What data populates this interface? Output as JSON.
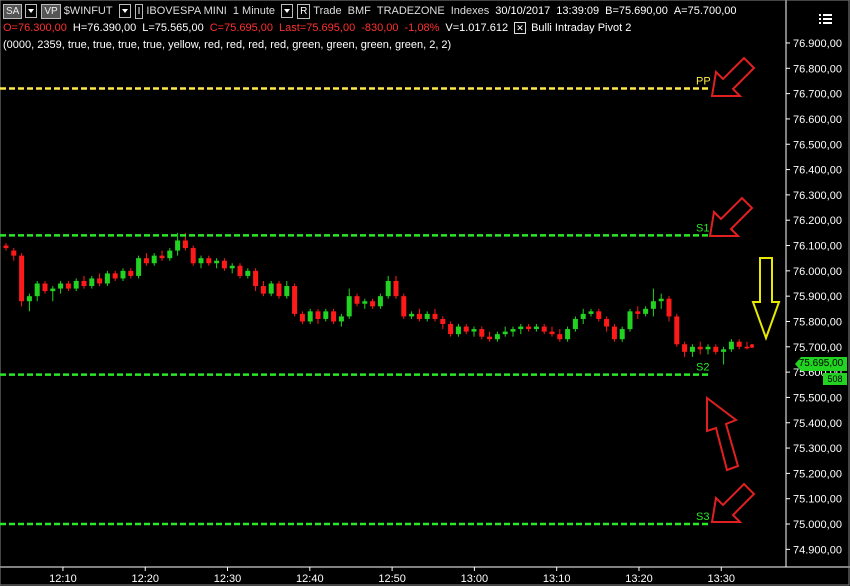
{
  "header": {
    "sa_label": "SA",
    "vp_label": "VP",
    "symbol": "$WINFUT",
    "instrument_name": "IBOVESPA MINI",
    "interval": "1 Minute",
    "interval_button": "I",
    "mode_button": "R",
    "trade_label": "Trade",
    "exchange": "BMF",
    "provider": "TRADEZONE",
    "category": "Indexes",
    "date": "30/10/2017",
    "time": "13:39:09",
    "bid": "B=75.690,00",
    "ask": "A=75.700,00",
    "open": "O=76.300,00",
    "high": "H=76.390,00",
    "low": "L=75.565,00",
    "close": "C=75.695,00",
    "last": "Last=75.695,00",
    "change": "-830,00",
    "change_pct": "-1,08%",
    "volume": "V=1.017.612",
    "indicator_name": "Bulli Intraday Pivot 2",
    "indicator_params": "(0000,  2359,  true,  true,  true,  true,  yellow,  red,  red,  red,  red,  green,  green,  green,  green,  2,  2)",
    "menu_icon": "hamburger-list-icon"
  },
  "current_price_label": "75.695,00",
  "volume_label": "508",
  "colors": {
    "background": "#000000",
    "up_candle": "#22d322",
    "down_candle": "#ff1a1a",
    "pivot_line": "#ffe84a",
    "support_line": "#28e828",
    "arrow_red": "#e02020",
    "arrow_yellow": "#e8e800",
    "axis_text": "#ffffff",
    "red_text": "#ff3030"
  },
  "chart_data": {
    "type": "candlestick",
    "ylim": [
      74850,
      77050
    ],
    "y_ticks": [
      {
        "value": 76900,
        "label": "76.900,00"
      },
      {
        "value": 76800,
        "label": "76.800,00"
      },
      {
        "value": 76700,
        "label": "76.700,00"
      },
      {
        "value": 76600,
        "label": "76.600,00"
      },
      {
        "value": 76500,
        "label": "76.500,00"
      },
      {
        "value": 76400,
        "label": "76.400,00"
      },
      {
        "value": 76300,
        "label": "76.300,00"
      },
      {
        "value": 76200,
        "label": "76.200,00"
      },
      {
        "value": 76100,
        "label": "76.100,00"
      },
      {
        "value": 76000,
        "label": "76.000,00"
      },
      {
        "value": 75900,
        "label": "75.900,00"
      },
      {
        "value": 75800,
        "label": "75.800,00"
      },
      {
        "value": 75700,
        "label": "75.700,00"
      },
      {
        "value": 75600,
        "label": "75.600,00"
      },
      {
        "value": 75500,
        "label": "75.500,00"
      },
      {
        "value": 75400,
        "label": "75.400,00"
      },
      {
        "value": 75300,
        "label": "75.300,00"
      },
      {
        "value": 75200,
        "label": "75.200,00"
      },
      {
        "value": 75100,
        "label": "75.100,00"
      },
      {
        "value": 75000,
        "label": "75.000,00"
      },
      {
        "value": 74900,
        "label": "74.900,00"
      }
    ],
    "x_ticks": [
      "12:10",
      "12:20",
      "12:30",
      "12:40",
      "12:50",
      "13:00",
      "13:10",
      "13:20",
      "13:30"
    ],
    "pivot_levels": [
      {
        "name": "PP",
        "value": 76720,
        "color": "#ffe84a"
      },
      {
        "name": "S1",
        "value": 76140,
        "color": "#28e828"
      },
      {
        "name": "S2",
        "value": 75590,
        "color": "#28e828"
      },
      {
        "name": "S3",
        "value": 75000,
        "color": "#28e828"
      }
    ],
    "candles": [
      {
        "o": 76100,
        "h": 76110,
        "l": 76080,
        "c": 76090
      },
      {
        "o": 76080,
        "h": 76090,
        "l": 76040,
        "c": 76060
      },
      {
        "o": 76060,
        "h": 76070,
        "l": 75860,
        "c": 75880
      },
      {
        "o": 75880,
        "h": 75910,
        "l": 75840,
        "c": 75900
      },
      {
        "o": 75900,
        "h": 75960,
        "l": 75880,
        "c": 75950
      },
      {
        "o": 75950,
        "h": 75960,
        "l": 75910,
        "c": 75920
      },
      {
        "o": 75920,
        "h": 75940,
        "l": 75880,
        "c": 75930
      },
      {
        "o": 75930,
        "h": 75960,
        "l": 75910,
        "c": 75950
      },
      {
        "o": 75950,
        "h": 75960,
        "l": 75920,
        "c": 75930
      },
      {
        "o": 75930,
        "h": 75970,
        "l": 75920,
        "c": 75960
      },
      {
        "o": 75960,
        "h": 75980,
        "l": 75930,
        "c": 75940
      },
      {
        "o": 75940,
        "h": 75980,
        "l": 75930,
        "c": 75970
      },
      {
        "o": 75970,
        "h": 75990,
        "l": 75940,
        "c": 75950
      },
      {
        "o": 75950,
        "h": 76000,
        "l": 75940,
        "c": 75990
      },
      {
        "o": 75990,
        "h": 76000,
        "l": 75960,
        "c": 75970
      },
      {
        "o": 75970,
        "h": 76010,
        "l": 75960,
        "c": 76000
      },
      {
        "o": 76000,
        "h": 76010,
        "l": 75970,
        "c": 75980
      },
      {
        "o": 75980,
        "h": 76060,
        "l": 75970,
        "c": 76050
      },
      {
        "o": 76050,
        "h": 76070,
        "l": 76020,
        "c": 76030
      },
      {
        "o": 76030,
        "h": 76070,
        "l": 76020,
        "c": 76060
      },
      {
        "o": 76060,
        "h": 76080,
        "l": 76040,
        "c": 76050
      },
      {
        "o": 76050,
        "h": 76090,
        "l": 76040,
        "c": 76080
      },
      {
        "o": 76080,
        "h": 76150,
        "l": 76060,
        "c": 76120
      },
      {
        "o": 76120,
        "h": 76150,
        "l": 76080,
        "c": 76090
      },
      {
        "o": 76090,
        "h": 76100,
        "l": 76020,
        "c": 76030
      },
      {
        "o": 76030,
        "h": 76060,
        "l": 76010,
        "c": 76050
      },
      {
        "o": 76050,
        "h": 76060,
        "l": 76020,
        "c": 76030
      },
      {
        "o": 76030,
        "h": 76050,
        "l": 76010,
        "c": 76040
      },
      {
        "o": 76040,
        "h": 76050,
        "l": 76000,
        "c": 76010
      },
      {
        "o": 76010,
        "h": 76030,
        "l": 75990,
        "c": 76020
      },
      {
        "o": 76020,
        "h": 76030,
        "l": 75970,
        "c": 75980
      },
      {
        "o": 75980,
        "h": 76010,
        "l": 75970,
        "c": 76000
      },
      {
        "o": 76000,
        "h": 76010,
        "l": 75920,
        "c": 75940
      },
      {
        "o": 75940,
        "h": 75960,
        "l": 75900,
        "c": 75910
      },
      {
        "o": 75910,
        "h": 75960,
        "l": 75900,
        "c": 75950
      },
      {
        "o": 75950,
        "h": 75960,
        "l": 75890,
        "c": 75900
      },
      {
        "o": 75900,
        "h": 75960,
        "l": 75890,
        "c": 75940
      },
      {
        "o": 75940,
        "h": 75950,
        "l": 75820,
        "c": 75830
      },
      {
        "o": 75830,
        "h": 75840,
        "l": 75790,
        "c": 75800
      },
      {
        "o": 75800,
        "h": 75850,
        "l": 75790,
        "c": 75840
      },
      {
        "o": 75840,
        "h": 75850,
        "l": 75790,
        "c": 75810
      },
      {
        "o": 75810,
        "h": 75850,
        "l": 75800,
        "c": 75840
      },
      {
        "o": 75840,
        "h": 75850,
        "l": 75790,
        "c": 75800
      },
      {
        "o": 75800,
        "h": 75830,
        "l": 75780,
        "c": 75820
      },
      {
        "o": 75820,
        "h": 75930,
        "l": 75810,
        "c": 75900
      },
      {
        "o": 75900,
        "h": 75910,
        "l": 75860,
        "c": 75870
      },
      {
        "o": 75870,
        "h": 75890,
        "l": 75850,
        "c": 75880
      },
      {
        "o": 75880,
        "h": 75890,
        "l": 75850,
        "c": 75860
      },
      {
        "o": 75860,
        "h": 75910,
        "l": 75850,
        "c": 75900
      },
      {
        "o": 75900,
        "h": 75980,
        "l": 75890,
        "c": 75960
      },
      {
        "o": 75960,
        "h": 75980,
        "l": 75890,
        "c": 75900
      },
      {
        "o": 75900,
        "h": 75910,
        "l": 75810,
        "c": 75820
      },
      {
        "o": 75820,
        "h": 75840,
        "l": 75810,
        "c": 75830
      },
      {
        "o": 75830,
        "h": 75850,
        "l": 75800,
        "c": 75810
      },
      {
        "o": 75810,
        "h": 75840,
        "l": 75800,
        "c": 75830
      },
      {
        "o": 75830,
        "h": 75850,
        "l": 75800,
        "c": 75810
      },
      {
        "o": 75810,
        "h": 75820,
        "l": 75770,
        "c": 75790
      },
      {
        "o": 75790,
        "h": 75800,
        "l": 75740,
        "c": 75750
      },
      {
        "o": 75750,
        "h": 75790,
        "l": 75740,
        "c": 75780
      },
      {
        "o": 75780,
        "h": 75790,
        "l": 75750,
        "c": 75760
      },
      {
        "o": 75760,
        "h": 75780,
        "l": 75740,
        "c": 75770
      },
      {
        "o": 75770,
        "h": 75780,
        "l": 75730,
        "c": 75740
      },
      {
        "o": 75740,
        "h": 75760,
        "l": 75720,
        "c": 75730
      },
      {
        "o": 75730,
        "h": 75760,
        "l": 75720,
        "c": 75750
      },
      {
        "o": 75750,
        "h": 75780,
        "l": 75740,
        "c": 75760
      },
      {
        "o": 75760,
        "h": 75780,
        "l": 75740,
        "c": 75770
      },
      {
        "o": 75770,
        "h": 75790,
        "l": 75750,
        "c": 75780
      },
      {
        "o": 75780,
        "h": 75790,
        "l": 75760,
        "c": 75770
      },
      {
        "o": 75770,
        "h": 75790,
        "l": 75760,
        "c": 75780
      },
      {
        "o": 75780,
        "h": 75790,
        "l": 75750,
        "c": 75760
      },
      {
        "o": 75760,
        "h": 75780,
        "l": 75740,
        "c": 75750
      },
      {
        "o": 75750,
        "h": 75770,
        "l": 75720,
        "c": 75730
      },
      {
        "o": 75730,
        "h": 75780,
        "l": 75720,
        "c": 75770
      },
      {
        "o": 75770,
        "h": 75820,
        "l": 75760,
        "c": 75810
      },
      {
        "o": 75810,
        "h": 75850,
        "l": 75790,
        "c": 75830
      },
      {
        "o": 75830,
        "h": 75850,
        "l": 75820,
        "c": 75840
      },
      {
        "o": 75840,
        "h": 75850,
        "l": 75800,
        "c": 75810
      },
      {
        "o": 75810,
        "h": 75820,
        "l": 75760,
        "c": 75780
      },
      {
        "o": 75780,
        "h": 75790,
        "l": 75720,
        "c": 75730
      },
      {
        "o": 75730,
        "h": 75780,
        "l": 75720,
        "c": 75770
      },
      {
        "o": 75770,
        "h": 75850,
        "l": 75760,
        "c": 75840
      },
      {
        "o": 75840,
        "h": 75860,
        "l": 75810,
        "c": 75830
      },
      {
        "o": 75830,
        "h": 75860,
        "l": 75820,
        "c": 75850
      },
      {
        "o": 75850,
        "h": 75930,
        "l": 75820,
        "c": 75880
      },
      {
        "o": 75880,
        "h": 75910,
        "l": 75850,
        "c": 75890
      },
      {
        "o": 75890,
        "h": 75900,
        "l": 75800,
        "c": 75820
      },
      {
        "o": 75820,
        "h": 75830,
        "l": 75700,
        "c": 75710
      },
      {
        "o": 75710,
        "h": 75720,
        "l": 75660,
        "c": 75680
      },
      {
        "o": 75680,
        "h": 75710,
        "l": 75660,
        "c": 75700
      },
      {
        "o": 75700,
        "h": 75720,
        "l": 75670,
        "c": 75690
      },
      {
        "o": 75690,
        "h": 75710,
        "l": 75670,
        "c": 75700
      },
      {
        "o": 75700,
        "h": 75710,
        "l": 75670,
        "c": 75680
      },
      {
        "o": 75680,
        "h": 75700,
        "l": 75630,
        "c": 75690
      },
      {
        "o": 75690,
        "h": 75730,
        "l": 75680,
        "c": 75720
      },
      {
        "o": 75720,
        "h": 75730,
        "l": 75690,
        "c": 75700
      },
      {
        "o": 75700,
        "h": 75720,
        "l": 75690,
        "c": 75695
      }
    ]
  }
}
